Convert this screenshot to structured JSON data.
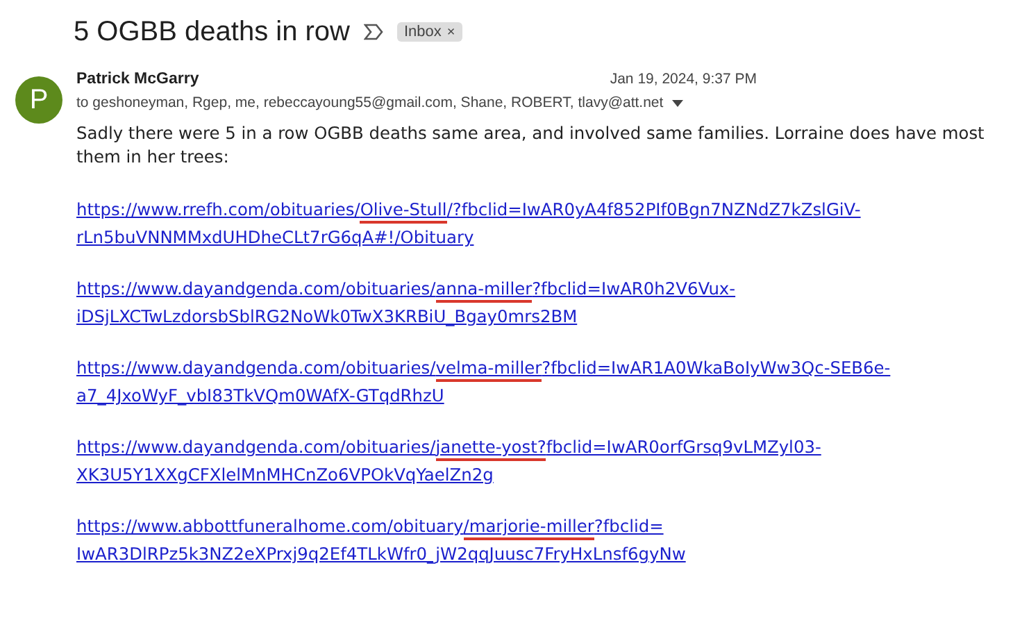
{
  "subject": "5 OGBB deaths in row",
  "label_chip": {
    "label": "Inbox",
    "remove": "×"
  },
  "message": {
    "avatar_letter": "P",
    "sender": "Patrick McGarry",
    "date": "Jan 19, 2024, 9:37 PM",
    "recipients": "to geshoneyman, Rgep, me, rebeccayoung55@gmail.com, Shane, ROBERT, tlavy@att.net",
    "body": "Sadly there were 5 in a row OGBB deaths same area, and involved same families.  Lorraine does have most them in her trees:",
    "links": [
      {
        "line_1_start": "https://www.rrefh.com/obituaries/",
        "highlighted": "Olive-Stull",
        "line_1_end": "/?fbclid=IwAR0yA4f852PIf0Bgn7NZNdZ7kZslGiV-",
        "line_2": "rLn5buVNNMMxdUHDheCLt7rG6qA#!/Obituary"
      },
      {
        "line_1_start": "https://www.dayandgenda.com/obituaries/",
        "highlighted": "anna-miller",
        "line_1_end": "?fbclid=IwAR0h2V6Vux-",
        "line_2": "iDSjLXCTwLzdorsbSblRG2NoWk0TwX3KRBiU_Bgay0mrs2BM"
      },
      {
        "line_1_start": "https://www.dayandgenda.com/obituaries/",
        "highlighted": "velma-miller",
        "line_1_end": "?fbclid=IwAR1A0WkaBoIyWw3Qc-SEB6e-",
        "line_2": "a7_4JxoWyF_vbI83TkVQm0WAfX-GTqdRhzU"
      },
      {
        "line_1_start": "https://www.dayandgenda.com/obituaries/",
        "highlighted": "janette-yost?",
        "line_1_end": "fbclid=IwAR0orfGrsq9vLMZyl03-",
        "line_2": "XK3U5Y1XXgCFXlelMnMHCnZo6VPOkVqYaelZn2g"
      },
      {
        "line_1_start": "https://www.abbottfuneralhome.com/obituary",
        "highlighted": "/marjorie-miller",
        "line_1_end": "?fbclid=",
        "line_2": "IwAR3DlRPz5k3NZ2eXPrxj9q2Ef4TLkWfr0_jW2qqJuusc7FryHxLnsf6gyNw"
      }
    ]
  }
}
